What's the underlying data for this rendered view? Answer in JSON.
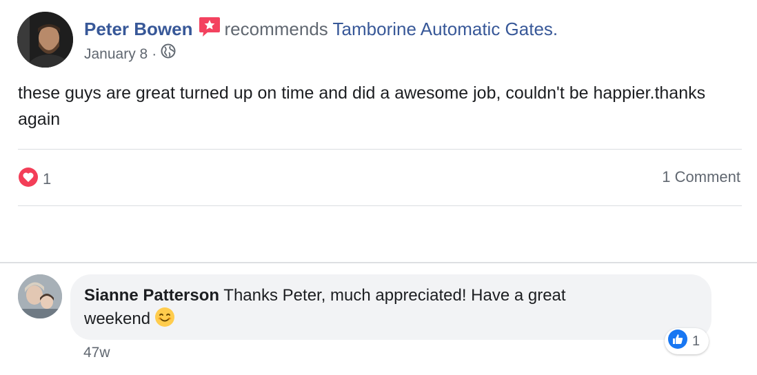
{
  "post": {
    "author": "Peter Bowen",
    "action": "recommends",
    "page_name": "Tamborine Automatic Gates.",
    "date": "January 8",
    "date_separator": "·",
    "text": "these guys are great turned up on time and did a awesome job, couldn't be happier.thanks again",
    "reaction_count": "1",
    "comment_count_label": "1 Comment"
  },
  "comment": {
    "author": "Sianne Patterson",
    "text": "Thanks Peter, much appreciated! Have a great weekend",
    "time": "47w",
    "like_count": "1"
  },
  "colors": {
    "link": "#385898",
    "muted": "#606770",
    "recommend_badge": "#f3425f",
    "love": "#f33e58",
    "like": "#1877f2",
    "bubble": "#f2f3f5"
  },
  "icons": {
    "recommend": "recommend-star-badge-icon",
    "privacy": "globe-icon",
    "reaction": "love-heart-icon",
    "comment_reaction": "like-thumb-icon",
    "emoji": "smiling-face-emoji"
  }
}
